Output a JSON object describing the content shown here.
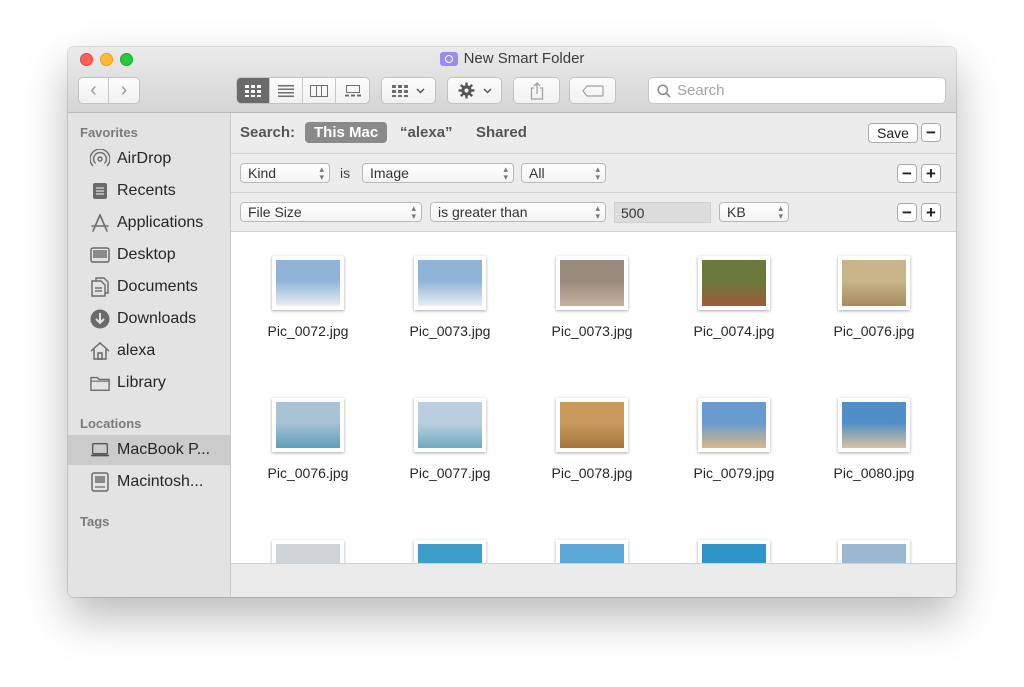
{
  "window": {
    "title": "New Smart Folder"
  },
  "toolbar": {
    "back_label": "‹",
    "forward_label": "›",
    "search_placeholder": "Search",
    "share_icon": "share-icon",
    "tag_icon": "tag-icon"
  },
  "sidebar": {
    "favorites_label": "Favorites",
    "favorites": [
      {
        "label": "AirDrop",
        "icon": "airdrop-icon"
      },
      {
        "label": "Recents",
        "icon": "recents-icon"
      },
      {
        "label": "Applications",
        "icon": "applications-icon"
      },
      {
        "label": "Desktop",
        "icon": "desktop-icon"
      },
      {
        "label": "Documents",
        "icon": "documents-icon"
      },
      {
        "label": "Downloads",
        "icon": "downloads-icon"
      },
      {
        "label": "alexa",
        "icon": "home-icon"
      },
      {
        "label": "Library",
        "icon": "folder-icon"
      }
    ],
    "locations_label": "Locations",
    "locations": [
      {
        "label": "MacBook P...",
        "icon": "laptop-icon",
        "selected": true
      },
      {
        "label": "Macintosh...",
        "icon": "disk-icon",
        "selected": false
      }
    ],
    "tags_label": "Tags"
  },
  "search_bar": {
    "label": "Search:",
    "scopes": [
      "This Mac",
      "“alexa”",
      "Shared"
    ],
    "active_scope": "This Mac",
    "save_label": "Save",
    "minus": "−",
    "plus": "+"
  },
  "criteria": [
    {
      "attribute": "Kind",
      "operator": "is",
      "value": "Image",
      "extra": "All"
    },
    {
      "attribute": "File Size",
      "operator": "is greater than",
      "value": "500",
      "unit": "KB"
    }
  ],
  "files": [
    {
      "name": "Pic_0072.jpg",
      "colors": [
        "#8fb4d8",
        "#e9eef2"
      ]
    },
    {
      "name": "Pic_0073.jpg",
      "colors": [
        "#8fb4d8",
        "#e9eef2"
      ]
    },
    {
      "name": "Pic_0073.jpg",
      "colors": [
        "#9a8a7c",
        "#c4b3a0"
      ]
    },
    {
      "name": "Pic_0074.jpg",
      "colors": [
        "#6b7a3a",
        "#a05a3a"
      ]
    },
    {
      "name": "Pic_0076.jpg",
      "colors": [
        "#c9b48a",
        "#a88a5e"
      ]
    },
    {
      "name": "Pic_0076.jpg",
      "colors": [
        "#a9c2d6",
        "#5f9db8"
      ]
    },
    {
      "name": "Pic_0077.jpg",
      "colors": [
        "#b9cfe0",
        "#6fa9be"
      ]
    },
    {
      "name": "Pic_0078.jpg",
      "colors": [
        "#c99a5e",
        "#a4753f"
      ]
    },
    {
      "name": "Pic_0079.jpg",
      "colors": [
        "#6a9bd0",
        "#d8b88a"
      ]
    },
    {
      "name": "Pic_0080.jpg",
      "colors": [
        "#4f8fc6",
        "#d9c2a0"
      ]
    },
    {
      "name": "",
      "colors": [
        "#cfd4d8",
        "#b8a88e"
      ]
    },
    {
      "name": "",
      "colors": [
        "#3c9fc8",
        "#2d8dbb"
      ]
    },
    {
      "name": "",
      "colors": [
        "#5aa8d6",
        "#c9a58a"
      ]
    },
    {
      "name": "",
      "colors": [
        "#2f95c9",
        "#4aaed8"
      ]
    },
    {
      "name": "",
      "colors": [
        "#9ab8d0",
        "#b89a72"
      ]
    }
  ]
}
